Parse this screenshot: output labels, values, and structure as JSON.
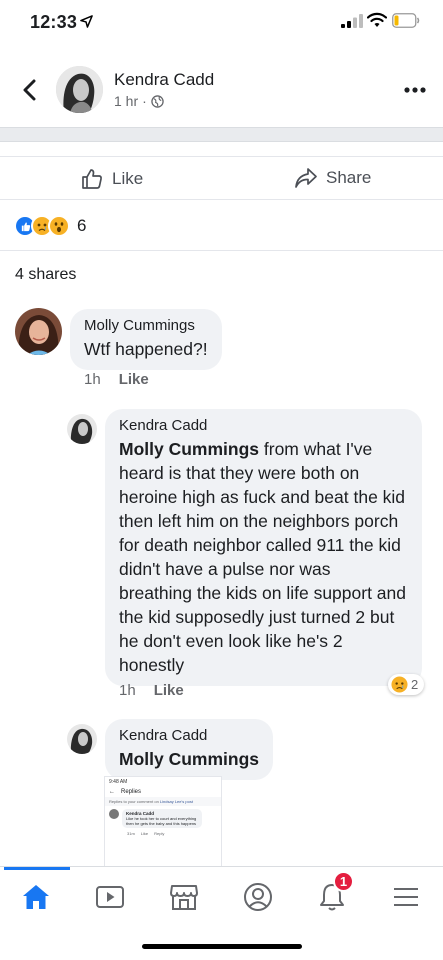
{
  "status_bar": {
    "time": "12:33",
    "icons": [
      "location-arrow-icon",
      "signal-icon",
      "wifi-icon",
      "battery-icon"
    ]
  },
  "post": {
    "author": "Kendra Cadd",
    "time": "1 hr",
    "separator": "·",
    "privacy_icon": "globe-icon",
    "actions": {
      "like_label": "Like",
      "share_label": "Share"
    },
    "reactions": {
      "types": [
        "like",
        "sad",
        "wow"
      ],
      "count": "6"
    },
    "shares_label": "4 shares"
  },
  "comments": [
    {
      "author": "Molly Cummings",
      "text": "Wtf happened?!",
      "time": "1h",
      "like_label": "Like"
    },
    {
      "author": "Kendra Cadd",
      "mention": "Molly Cummings",
      "text": " from what I've heard is that they were both on heroine high as fuck and beat the kid then left him on the neighbors porch for death neighbor called 911 the kid didn't have a pulse nor was breathing the kids on life support and the kid supposedly just turned 2 but he don't even look like he's 2 honestly",
      "time": "1h",
      "like_label": "Like",
      "reaction_count": "2"
    },
    {
      "author": "Kendra Cadd",
      "mention": "Molly Cummings",
      "attachment": {
        "status_time": "9:48 AM",
        "header": "Replies",
        "subheader_prefix": "Replies to your comment on ",
        "subheader_link": "Lindsay Lee's post",
        "comment_author": "Kendra Cadd",
        "comment_text": "Like he took her to court and everything then he gets the baby and this happens",
        "comment_time": "31m",
        "comment_like": "Like",
        "comment_reply": "Reply"
      }
    }
  ],
  "tabbar": {
    "tabs": [
      "home-icon",
      "video-icon",
      "marketplace-icon",
      "profile-icon",
      "notifications-icon",
      "menu-icon"
    ],
    "notification_badge": "1",
    "accent": "#1877f2"
  }
}
